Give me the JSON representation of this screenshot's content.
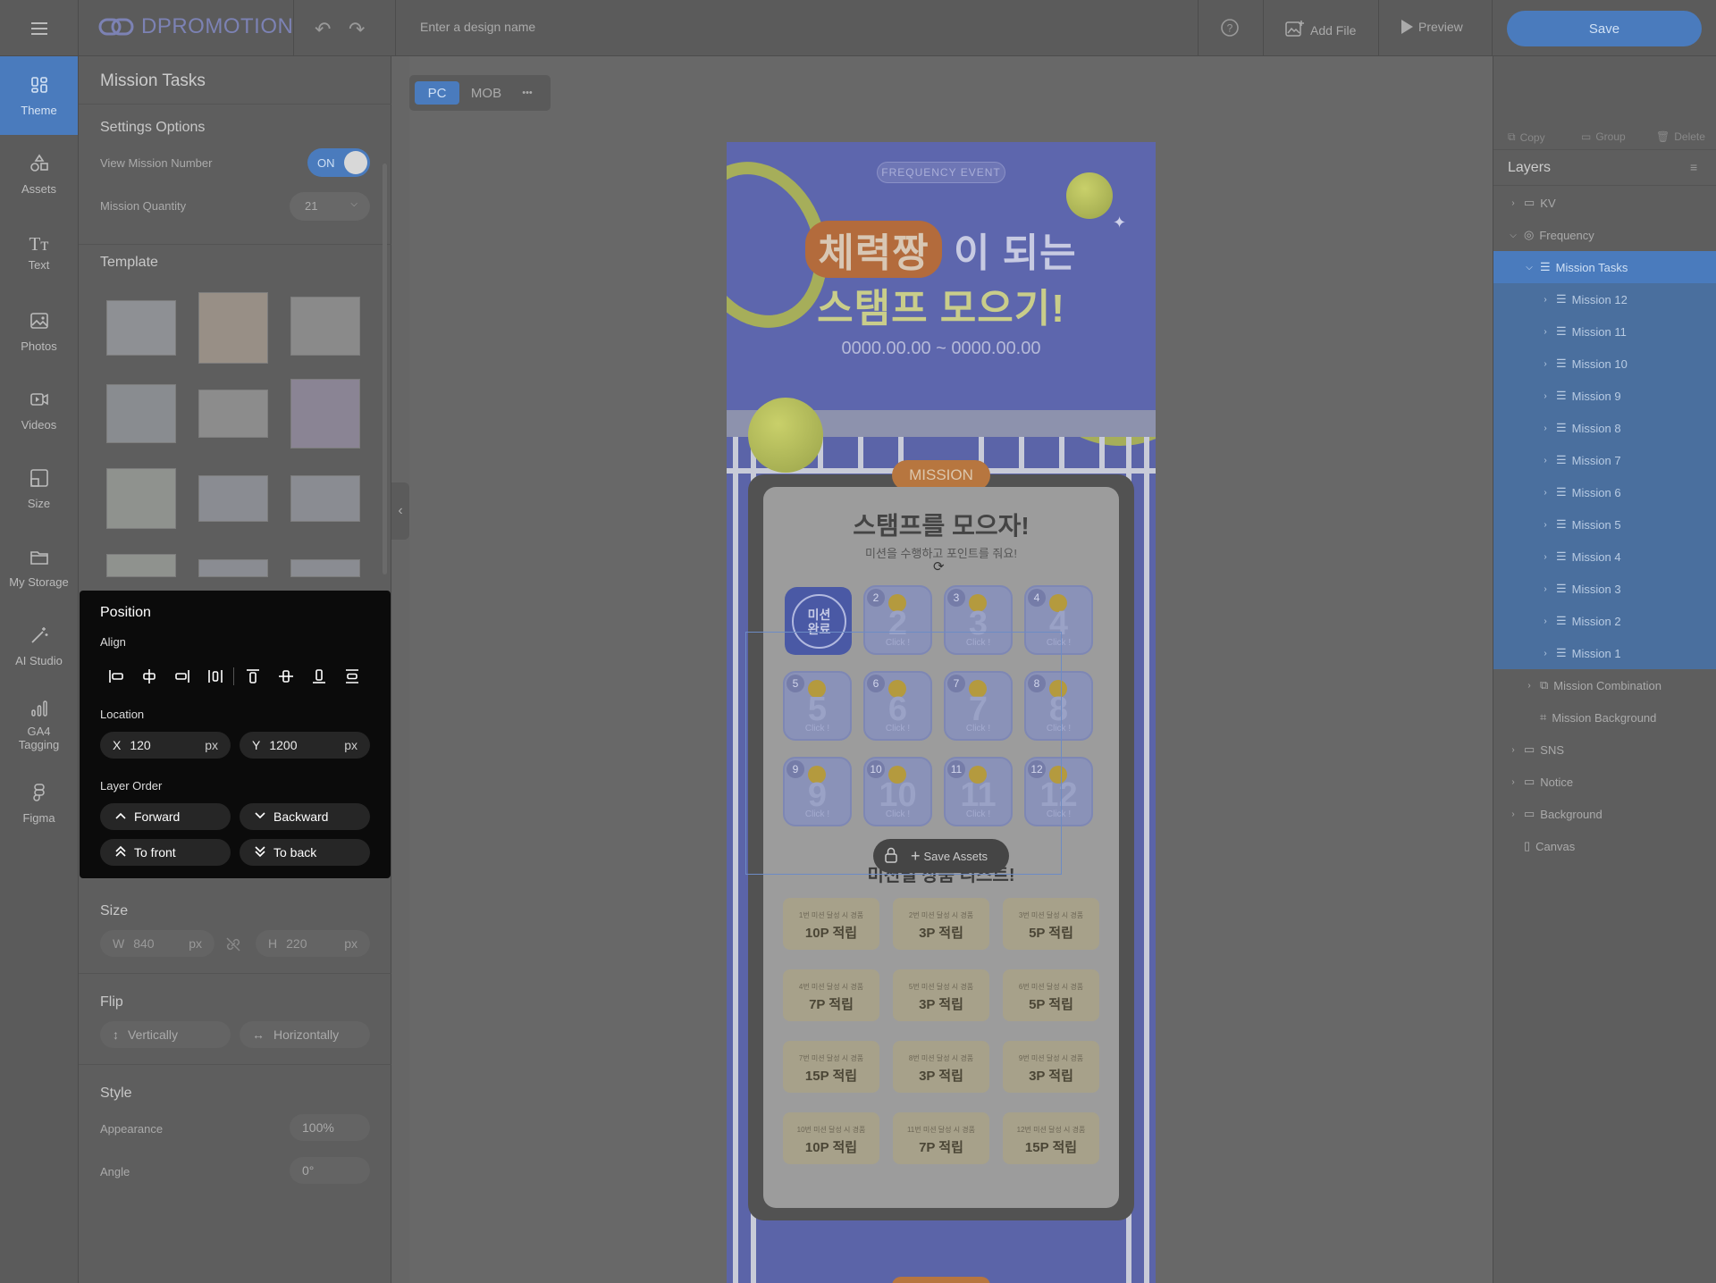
{
  "topbar": {
    "logo": "DPROMOTION",
    "design_name_placeholder": "Enter a design name",
    "add_file": "Add File",
    "preview": "Preview",
    "save": "Save"
  },
  "sidenav": [
    {
      "label": "Theme",
      "icon": "theme-icon"
    },
    {
      "label": "Assets",
      "icon": "assets-icon"
    },
    {
      "label": "Text",
      "icon": "text-icon"
    },
    {
      "label": "Photos",
      "icon": "photos-icon"
    },
    {
      "label": "Videos",
      "icon": "videos-icon"
    },
    {
      "label": "Size",
      "icon": "size-icon"
    },
    {
      "label": "My Storage",
      "icon": "folder-icon"
    },
    {
      "label": "AI Studio",
      "icon": "ai-wand-icon"
    },
    {
      "label": "GA4 Tagging",
      "icon": "analytics-icon"
    },
    {
      "label": "Figma",
      "icon": "figma-icon"
    }
  ],
  "panel": {
    "title": "Mission Tasks",
    "settings_title": "Settings Options",
    "view_mission_number": "View Mission Number",
    "toggle_state": "ON",
    "mission_quantity": "Mission Quantity",
    "quantity_value": "21",
    "template_title": "Template",
    "size_title": "Size",
    "width_label": "W",
    "width_value": "840",
    "height_label": "H",
    "height_value": "220",
    "unit": "px",
    "flip_title": "Flip",
    "flip_vertical": "Vertically",
    "flip_horizontal": "Horizontally",
    "style_title": "Style",
    "appearance_label": "Appearance",
    "appearance_value": "100%",
    "angle_label": "Angle",
    "angle_value": "0°"
  },
  "position": {
    "title": "Position",
    "align_label": "Align",
    "location_label": "Location",
    "x_label": "X",
    "x_value": "120",
    "y_label": "Y",
    "y_value": "1200",
    "unit": "px",
    "layer_order_label": "Layer Order",
    "forward": "Forward",
    "backward": "Backward",
    "to_front": "To front",
    "to_back": "To back"
  },
  "view_toggle": {
    "pc": "PC",
    "mob": "MOB",
    "more": "•••"
  },
  "design": {
    "badge": "FREQUENCY EVENT",
    "headline_pill": "체력짱",
    "headline_rest": "이 되는",
    "headline_line2": "스탬프 모으기!",
    "dates": "0000.00.00 ~ 0000.00.00",
    "mission_tag": "MISSION",
    "card_title": "스탬프를 모으자!",
    "card_subtitle": "미션을 수행하고 포인트를 줘요!",
    "done_label": "미션\n완료",
    "click_label": "Click !",
    "missions": [
      "2",
      "3",
      "4",
      "5",
      "6",
      "7",
      "8",
      "9",
      "10",
      "11",
      "12"
    ],
    "reward_title": "미션별 상품 리스트!",
    "save_assets": "Save Assets",
    "rewards": [
      {
        "cond": "1번 미션 달성 시 경품",
        "pts": "10P 적립"
      },
      {
        "cond": "2번 미션 달성 시 경품",
        "pts": "3P 적립"
      },
      {
        "cond": "3번 미션 달성 시 경품",
        "pts": "5P 적립"
      },
      {
        "cond": "4번 미션 달성 시 경품",
        "pts": "7P 적립"
      },
      {
        "cond": "5번 미션 달성 시 경품",
        "pts": "3P 적립"
      },
      {
        "cond": "6번 미션 달성 시 경품",
        "pts": "5P 적립"
      },
      {
        "cond": "7번 미션 달성 시 경품",
        "pts": "15P 적립"
      },
      {
        "cond": "8번 미션 달성 시 경품",
        "pts": "3P 적립"
      },
      {
        "cond": "9번 미션 달성 시 경품",
        "pts": "3P 적립"
      },
      {
        "cond": "10번 미션 달성 시 경품",
        "pts": "10P 적립"
      },
      {
        "cond": "11번 미션 달성 시 경품",
        "pts": "7P 적립"
      },
      {
        "cond": "12번 미션 달성 시 경품",
        "pts": "15P 적립"
      }
    ]
  },
  "layers": {
    "copy": "Copy",
    "group": "Group",
    "delete": "Delete",
    "title": "Layers",
    "items": [
      {
        "label": "KV",
        "level": 0,
        "type": "folder",
        "state": "none"
      },
      {
        "label": "Frequency",
        "level": 0,
        "type": "group",
        "state": "none",
        "open": true
      },
      {
        "label": "Mission Tasks",
        "level": 1,
        "type": "list",
        "state": "selected",
        "open": true
      },
      {
        "label": "Mission 12",
        "level": 2,
        "type": "list",
        "state": "child"
      },
      {
        "label": "Mission 11",
        "level": 2,
        "type": "list",
        "state": "child"
      },
      {
        "label": "Mission 10",
        "level": 2,
        "type": "list",
        "state": "child"
      },
      {
        "label": "Mission 9",
        "level": 2,
        "type": "list",
        "state": "child"
      },
      {
        "label": "Mission 8",
        "level": 2,
        "type": "list",
        "state": "child"
      },
      {
        "label": "Mission 7",
        "level": 2,
        "type": "list",
        "state": "child"
      },
      {
        "label": "Mission 6",
        "level": 2,
        "type": "list",
        "state": "child"
      },
      {
        "label": "Mission 5",
        "level": 2,
        "type": "list",
        "state": "child"
      },
      {
        "label": "Mission 4",
        "level": 2,
        "type": "list",
        "state": "child"
      },
      {
        "label": "Mission 3",
        "level": 2,
        "type": "list",
        "state": "child"
      },
      {
        "label": "Mission 2",
        "level": 2,
        "type": "list",
        "state": "child"
      },
      {
        "label": "Mission 1",
        "level": 2,
        "type": "list",
        "state": "child"
      },
      {
        "label": "Mission Combination",
        "level": 1,
        "type": "stack",
        "state": "none"
      },
      {
        "label": "Mission Background",
        "level": 1,
        "type": "frame",
        "state": "none",
        "nochev": true
      },
      {
        "label": "SNS",
        "level": 0,
        "type": "folder",
        "state": "none"
      },
      {
        "label": "Notice",
        "level": 0,
        "type": "folder",
        "state": "none"
      },
      {
        "label": "Background",
        "level": 0,
        "type": "folder",
        "state": "none"
      },
      {
        "label": "Canvas",
        "level": 0,
        "type": "canvas",
        "state": "none",
        "nochev": true
      }
    ]
  }
}
